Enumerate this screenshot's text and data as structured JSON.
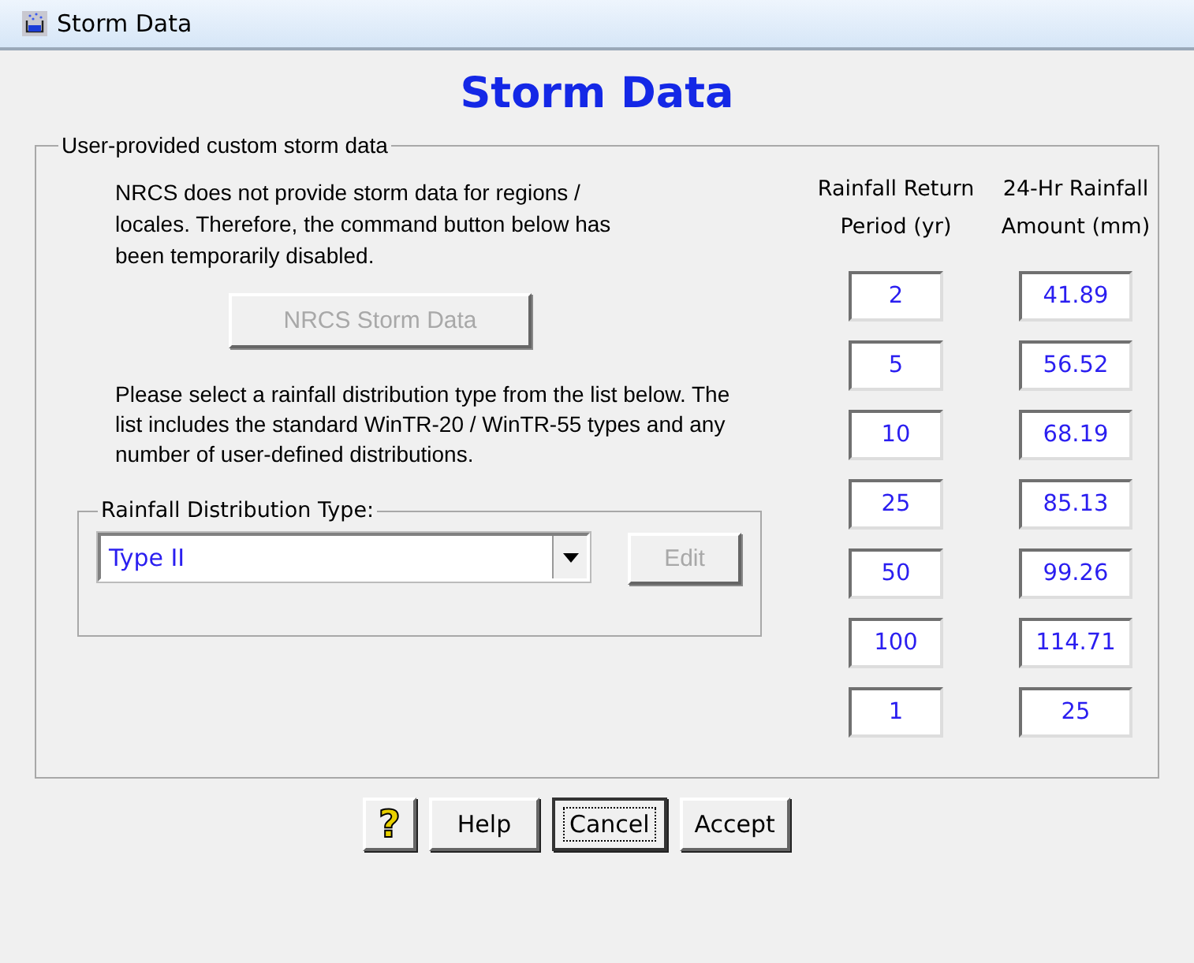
{
  "window": {
    "title": "Storm Data"
  },
  "heading": "Storm Data",
  "group": {
    "legend": "User-provided custom storm data",
    "notice": "NRCS does not provide storm data for regions / locales.  Therefore, the command button below has been temporarily disabled.",
    "nrcs_button": {
      "label": "NRCS Storm Data",
      "disabled": true
    },
    "instructions": "Please select a rainfall distribution type from the list below. The list includes the standard WinTR-20 / WinTR-55 types and any number of user-defined distributions.",
    "distribution": {
      "legend": "Rainfall Distribution Type:",
      "value": "Type II",
      "edit_button": {
        "label": "Edit",
        "disabled": true
      }
    },
    "columns": [
      "Rainfall Return Period (yr)",
      "24-Hr Rainfall Amount (mm)"
    ],
    "rows": [
      {
        "period": "2",
        "amount": "41.89"
      },
      {
        "period": "5",
        "amount": "56.52"
      },
      {
        "period": "10",
        "amount": "68.19"
      },
      {
        "period": "25",
        "amount": "85.13"
      },
      {
        "period": "50",
        "amount": "99.26"
      },
      {
        "period": "100",
        "amount": "114.71"
      },
      {
        "period": "1",
        "amount": "25"
      }
    ]
  },
  "buttons": [
    {
      "kind": "icon",
      "label": "?",
      "focused": false
    },
    {
      "kind": "text",
      "label": "Help",
      "focused": false
    },
    {
      "kind": "text",
      "label": "Cancel",
      "focused": true
    },
    {
      "kind": "text",
      "label": "Accept",
      "focused": false
    }
  ]
}
